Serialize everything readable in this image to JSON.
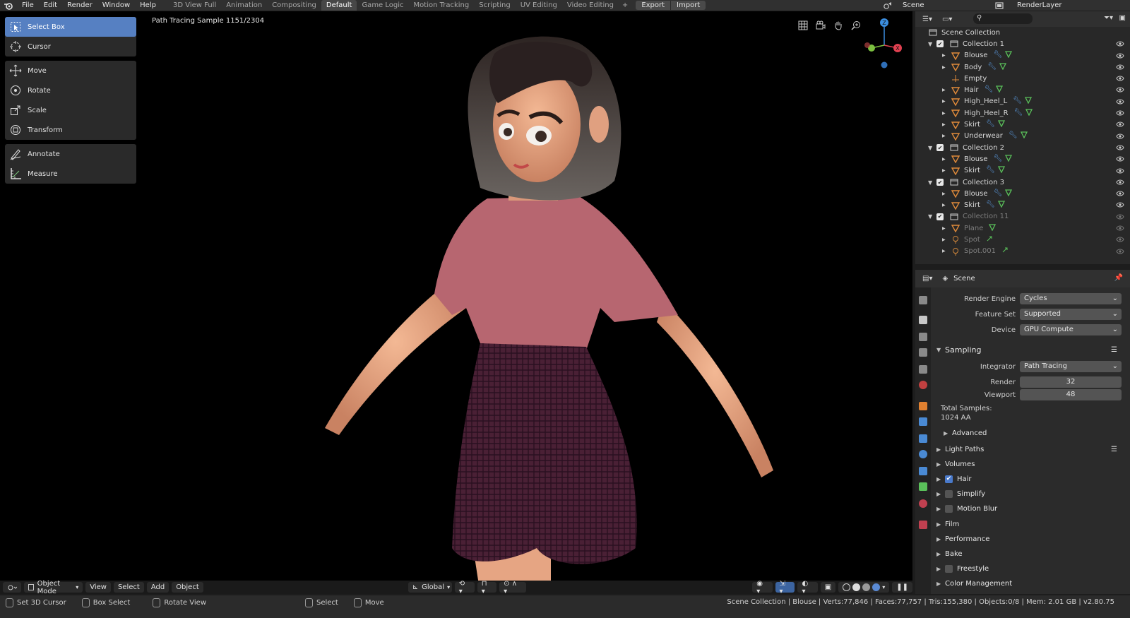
{
  "menu": {
    "items": [
      "File",
      "Edit",
      "Render",
      "Window",
      "Help"
    ]
  },
  "workspaces": {
    "tabs": [
      "3D View Full",
      "Animation",
      "Compositing",
      "Default",
      "Game Logic",
      "Motion Tracking",
      "Scripting",
      "UV Editing",
      "Video Editing"
    ],
    "active": "Default",
    "add": "+"
  },
  "toolbar_extra": {
    "export": "Export",
    "import": "Import"
  },
  "scene": {
    "name": "Scene"
  },
  "render_layer": {
    "name": "RenderLayer"
  },
  "viewport": {
    "status": "Path Tracing Sample 1151/2304",
    "tools": [
      {
        "label": "Select Box",
        "icon": "select-box-icon"
      },
      {
        "label": "Cursor",
        "icon": "cursor-icon"
      },
      {
        "label": "Move",
        "icon": "move-icon"
      },
      {
        "label": "Rotate",
        "icon": "rotate-icon"
      },
      {
        "label": "Scale",
        "icon": "scale-icon"
      },
      {
        "label": "Transform",
        "icon": "transform-icon"
      },
      {
        "label": "Annotate",
        "icon": "annotate-icon"
      },
      {
        "label": "Measure",
        "icon": "measure-icon"
      }
    ],
    "header": {
      "mode": "Object Mode",
      "view": "View",
      "select": "Select",
      "add": "Add",
      "object": "Object",
      "orientation": "Global"
    },
    "gizmo": {
      "z": "Z",
      "x": "X"
    }
  },
  "outliner": {
    "root": "Scene Collection",
    "rows": [
      {
        "label": "Collection 1",
        "type": "collection"
      },
      {
        "label": "Blouse",
        "type": "object"
      },
      {
        "label": "Body",
        "type": "object"
      },
      {
        "label": "Empty",
        "type": "empty"
      },
      {
        "label": "Hair",
        "type": "object"
      },
      {
        "label": "High_Heel_L",
        "type": "object"
      },
      {
        "label": "High_Heel_R",
        "type": "object"
      },
      {
        "label": "Skirt",
        "type": "object"
      },
      {
        "label": "Underwear",
        "type": "object"
      },
      {
        "label": "Collection 2",
        "type": "collection"
      },
      {
        "label": "Blouse",
        "type": "object"
      },
      {
        "label": "Skirt",
        "type": "object"
      },
      {
        "label": "Collection 3",
        "type": "collection"
      },
      {
        "label": "Blouse",
        "type": "object"
      },
      {
        "label": "Skirt",
        "type": "object"
      },
      {
        "label": "Collection 11",
        "type": "collection"
      },
      {
        "label": "Plane",
        "type": "object"
      },
      {
        "label": "Spot",
        "type": "light"
      },
      {
        "label": "Spot.001",
        "type": "light"
      }
    ]
  },
  "properties": {
    "context": "Scene",
    "render_engine_label": "Render Engine",
    "render_engine": "Cycles",
    "feature_set_label": "Feature Set",
    "feature_set": "Supported",
    "device_label": "Device",
    "device": "GPU Compute",
    "sampling": "Sampling",
    "integrator_label": "Integrator",
    "integrator": "Path Tracing",
    "render_label": "Render",
    "render_samples": "32",
    "viewport_label": "Viewport",
    "viewport_samples": "48",
    "total_samples_label": "Total Samples:",
    "total_samples": "1024 AA",
    "advanced": "Advanced",
    "panels": [
      "Light Paths",
      "Volumes",
      "Hair",
      "Simplify",
      "Motion Blur",
      "Film",
      "Performance",
      "Bake",
      "Freestyle",
      "Color Management"
    ]
  },
  "statusbar": {
    "set_cursor": "Set 3D Cursor",
    "box_select": "Box Select",
    "rotate_view": "Rotate View",
    "select": "Select",
    "move": "Move",
    "info": "Scene Collection | Blouse | Verts:77,846 | Faces:77,757 | Tris:155,380 | Objects:0/8 | Mem: 2.01 GB | v2.80.75"
  }
}
